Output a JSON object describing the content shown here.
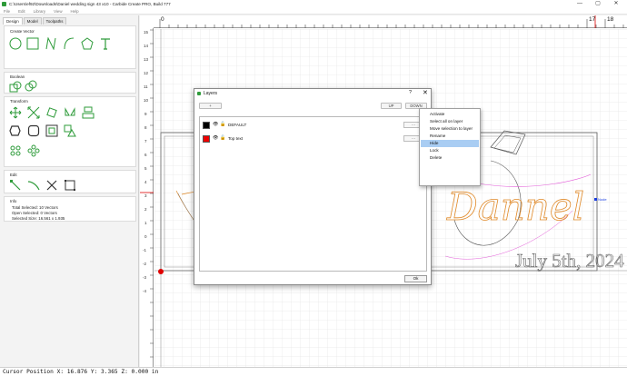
{
  "window": {
    "title": "C:\\Users\\ef92\\Downloads\\Daniel wedding sign 43 x10 - Carbide Create PRO, Build 777",
    "minimize": "—",
    "maximize": "▢",
    "close": "✕"
  },
  "menu": [
    "File",
    "Edit",
    "Library",
    "View",
    "Help"
  ],
  "left_panel": {
    "tabs": [
      "Design",
      "Model",
      "Toolpaths"
    ],
    "sections": {
      "create_vector": "Create Vector",
      "boolean": "Boolean",
      "transform": "Transform",
      "edit": "Edit",
      "info": "Info"
    },
    "info": {
      "total_selected": "Total Selected:  10 Vectors",
      "open_selected": "Open Selected:   0 Vectors",
      "selected_size": "Selected Size:   16.561 x 1.935"
    }
  },
  "rulers": {
    "top_labels": [
      "0",
      "17",
      "18"
    ],
    "left_labels": [
      "15",
      "14",
      "13",
      "12",
      "11",
      "10",
      "9",
      "8",
      "7",
      "6",
      "5",
      "4",
      "3",
      "2",
      "1",
      "0",
      "-1",
      "-2",
      "-3",
      "-4"
    ]
  },
  "canvas": {
    "date_text": "July 5th, 2024",
    "name_text": "Dannel",
    "node_label": "Node"
  },
  "status": {
    "cursor": "Cursor Position X: 16.876 Y: 3.365 Z: 0.000 in"
  },
  "layers_dialog": {
    "title": "Layers",
    "help": "?",
    "close": "✕",
    "add_button": "+",
    "up_button": "UP",
    "down_button": "DOWN",
    "ok_button": "Ok",
    "layers": [
      {
        "name": "DEFAULT",
        "color": "#000000",
        "menu": "..."
      },
      {
        "name": "Top text",
        "color": "#ee0000",
        "menu": "..."
      }
    ]
  },
  "context_menu": {
    "items": [
      "Activate",
      "Select all on layer",
      "Move selection to layer",
      "Rename",
      "Hide",
      "Lock",
      "Delete"
    ],
    "highlighted": "Hide"
  },
  "colors": {
    "accent_green": "#2e9b3a",
    "menu_highlight": "#a9cdf3",
    "vector_orange": "#e08a2a",
    "vector_pink": "#e25bd8"
  }
}
